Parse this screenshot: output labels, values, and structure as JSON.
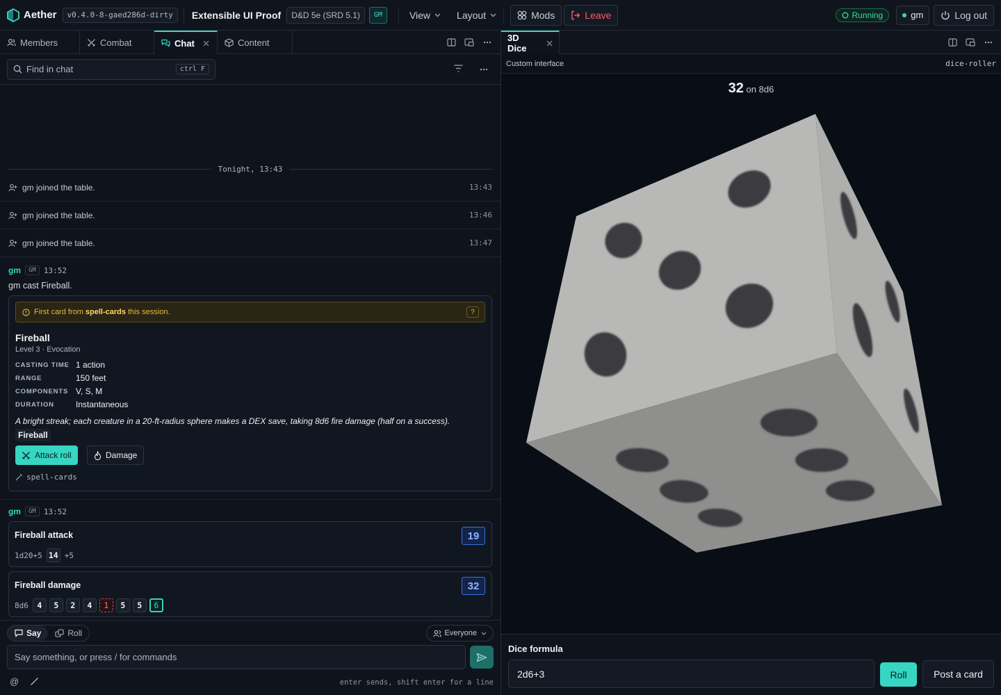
{
  "app": {
    "name": "Aether",
    "version": "v0.4.0-8-gaed286d-dirty",
    "campaign": "Extensible UI Proof",
    "ruleset": "D&D 5e (SRD 5.1)",
    "role_badge": "GM",
    "menus": [
      "View",
      "Layout"
    ],
    "mods_label": "Mods",
    "leave_label": "Leave",
    "status": "Running",
    "user": "gm",
    "logout_label": "Log out"
  },
  "left_panel": {
    "tabs": [
      {
        "label": "Members",
        "icon": "users-icon"
      },
      {
        "label": "Combat",
        "icon": "swords-icon"
      },
      {
        "label": "Chat",
        "icon": "chat-icon",
        "active": true
      },
      {
        "label": "Content",
        "icon": "package-icon"
      }
    ],
    "search": {
      "placeholder": "Find in chat",
      "shortcut": "ctrl F"
    }
  },
  "chat": {
    "separator": "Tonight, 13:43",
    "system_messages": [
      {
        "text": "gm joined the table.",
        "time": "13:43"
      },
      {
        "text": "gm joined the table.",
        "time": "13:46"
      },
      {
        "text": "gm joined the table.",
        "time": "13:47"
      }
    ],
    "message1": {
      "author": "gm",
      "badge": "GM",
      "time": "13:52",
      "text": "gm cast Fireball.",
      "notice": {
        "prefix": "First card from",
        "source": "spell-cards",
        "suffix": "this session.",
        "help": "?"
      },
      "spell": {
        "name": "Fireball",
        "subtitle": "Level 3 · Evocation",
        "properties": [
          {
            "key": "CASTING TIME",
            "value": "1 action"
          },
          {
            "key": "RANGE",
            "value": "150 feet"
          },
          {
            "key": "COMPONENTS",
            "value": "V, S, M"
          },
          {
            "key": "DURATION",
            "value": "Instantaneous"
          }
        ],
        "description": "A bright streak; each creature in a 20-ft-radius sphere makes a DEX save, taking 8d6 fire damage (half on a success).",
        "tag": "Fireball",
        "actions": [
          "Attack roll",
          "Damage"
        ],
        "source": "spell-cards"
      }
    },
    "message2": {
      "author": "gm",
      "badge": "GM",
      "time": "13:52",
      "rolls": [
        {
          "title": "Fireball attack",
          "total": "19",
          "formula": "1d20+5",
          "dice": [
            "14"
          ],
          "modifier": "+5"
        },
        {
          "title": "Fireball damage",
          "total": "32",
          "formula": "8d6",
          "dice": [
            "4",
            "5",
            "2",
            "4",
            "1",
            "5",
            "5",
            "6"
          ],
          "lowest": "1",
          "highest": "6"
        }
      ]
    }
  },
  "composer": {
    "modes": [
      "Say",
      "Roll"
    ],
    "active_mode": "Say",
    "audience": "Everyone",
    "placeholder": "Say something, or press / for commands",
    "tools": [
      "@",
      "/"
    ],
    "hint": "enter sends, shift enter for a line"
  },
  "right_panel": {
    "tab": "3D Dice",
    "subheader_left": "Custom interface",
    "subheader_right": "dice-roller",
    "result_total": "32",
    "result_formula": "on 8d6",
    "formula_label": "Dice formula",
    "formula_value": "2d6+3",
    "roll_label": "Roll",
    "post_label": "Post a card"
  },
  "colors": {
    "accent": "#36d6c3",
    "danger": "#ff5a63",
    "success": "#3fd89a",
    "warning": "#e4bc4a",
    "background": "#0f141c"
  }
}
